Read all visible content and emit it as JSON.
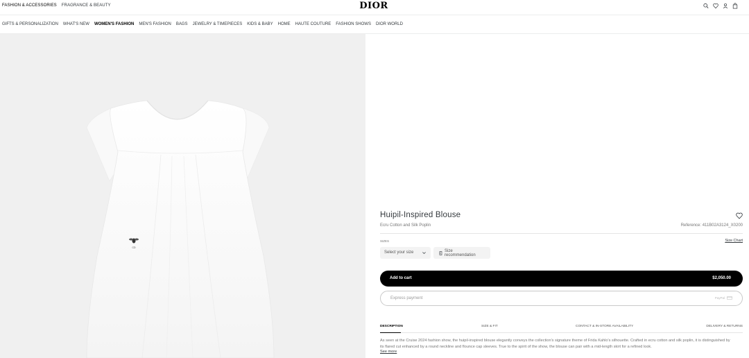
{
  "header": {
    "top_links": [
      "FASHION & ACCESSORIES",
      "FRAGRANCE & BEAUTY"
    ],
    "active_top_link": 0,
    "logo": "DIOR",
    "icons": [
      "search-icon",
      "heart-icon",
      "user-icon",
      "bag-icon"
    ]
  },
  "nav": {
    "items": [
      "GIFTS & PERSONALIZATION",
      "WHAT'S NEW",
      "WOMEN'S FASHION",
      "MEN'S FASHION",
      "BAGS",
      "JEWELRY & TIMEPIECES",
      "KIDS & BABY",
      "HOME",
      "HAUTE COUTURE",
      "FASHION SHOWS",
      "DIOR WORLD"
    ],
    "active_index": 2
  },
  "product": {
    "title": "Huipil-Inspired Blouse",
    "subtitle": "Ecru Cotton and Silk Poplin",
    "reference": "Reference: 411B02A3124_X0200",
    "size_label": "SIZES",
    "size_chart": "Size Chart",
    "size_select_placeholder": "Select your size",
    "size_recommendation": "Size recommendation",
    "add_to_cart": "Add to cart",
    "price": "$2,050.00",
    "express_payment": "Express payment",
    "express_payment_method": "PayPal"
  },
  "tabs": {
    "items": [
      "DESCRIPTION",
      "SIZE & FIT",
      "CONTACT & IN-STORE AVAILABILITY",
      "DELIVERY & RETURNS"
    ],
    "active_index": 0
  },
  "description": {
    "text": "As seen at the Cruise 2024 fashion show, the huipil-inspired blouse elegantly conveys the collection's signature theme of Frida Kahlo's silhouette. Crafted in ecru cotton and silk poplin, it is distinguished by its flared cut enhanced by a round neckline and flounce cap sleeves. True to the spirit of the show, the blouse can pair with a mid-length skirt for a refined look.",
    "see_more": "See more"
  },
  "image": {
    "emblem_text": "CD",
    "garment_color": "#fbfbfb",
    "background_color": "#f0f0f0"
  }
}
